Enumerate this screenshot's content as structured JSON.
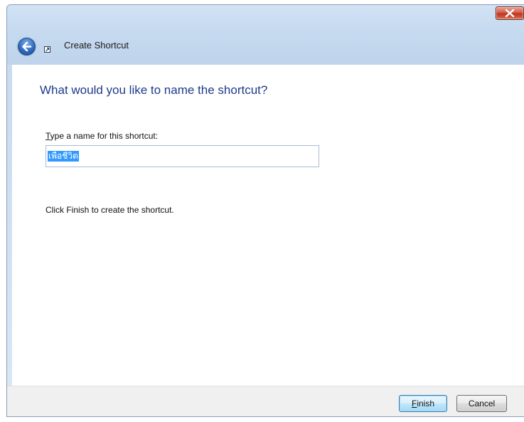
{
  "window": {
    "title": "Create Shortcut",
    "close_icon": "close-x-icon",
    "back_icon": "back-arrow-icon",
    "shortcut_icon": "shortcut-arrow-icon"
  },
  "main": {
    "heading": "What would you like to name the shortcut?",
    "label_mnemonic": "T",
    "label_rest": "ype a name for this shortcut:",
    "name_value": "เพื่อชีวิต",
    "hint": "Click Finish to create the shortcut."
  },
  "footer": {
    "finish_mnemonic": "F",
    "finish_rest": "inish",
    "cancel_label": "Cancel"
  },
  "colors": {
    "heading": "#1e3a8a",
    "selection": "#3399ff",
    "close_button": "#c8402a"
  }
}
